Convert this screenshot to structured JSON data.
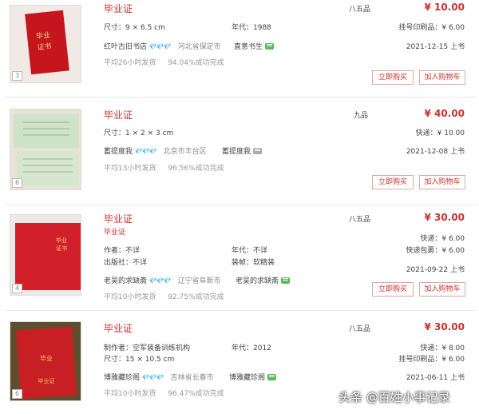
{
  "listings": [
    {
      "image_count": "3",
      "title": "毕业证",
      "size": "尺寸：9 × 6.5 cm",
      "year": "年代：1988",
      "shop": "红叶古旧书店",
      "gems": "💎💎💎",
      "location": "河北省保定市",
      "seller": "直意书生",
      "stats": [
        "平均26小时发货",
        "94.04%成功完成"
      ],
      "condition": "八五品",
      "price": "¥ 10.00",
      "shipping": [
        "挂号印刷品：¥ 6.00"
      ],
      "date": "2021-12-15 上书",
      "buy": "立即购买",
      "cart": "加入购物车"
    },
    {
      "image_count": "6",
      "title": "毕业证",
      "size": "尺寸：1 × 2 × 3 cm",
      "shop": "蓄提度我",
      "gems": "💎💎💎",
      "location": "北京市丰台区",
      "seller": "蓄提度我",
      "stats": [
        "平均13小时发货",
        "96.56%成功完成"
      ],
      "condition": "九品",
      "price": "¥ 40.00",
      "shipping": [
        "快递：¥ 10.00"
      ],
      "date": "2021-12-08 上书",
      "buy": "立即购买",
      "cart": "加入购物车"
    },
    {
      "image_count": "4",
      "title": "毕业证",
      "subtitle": "毕业证",
      "author": "作者：不详",
      "year": "年代：不详",
      "publisher": "出版社：不详",
      "binding": "装帧：软精装",
      "shop": "老吴的求缺斋",
      "gems": "💎💎💎",
      "location": "辽宁省阜新市",
      "seller": "老吴的求缺斋",
      "stats": [
        "平均10小时发货",
        "92.75%成功完成"
      ],
      "condition": "八五品",
      "price": "¥ 30.00",
      "shipping": [
        "快递：¥ 6.00",
        "快递包裹：¥ 6.00"
      ],
      "date": "2021-09-22 上书",
      "buy": "立即购买",
      "cart": "加入购物车"
    },
    {
      "image_count": "6",
      "title": "毕业证",
      "maker": "制作者：空军装备训练机构",
      "year": "年代：2012",
      "size": "尺寸：15 × 10.5 cm",
      "shop": "博雅藏珍阁",
      "gems": "💎💎💎",
      "location": "吉林省长春市",
      "seller": "博雅藏珍阁",
      "stats": [
        "平均10小时发货",
        "96.47%成功完成"
      ],
      "condition": "八五品",
      "price": "¥ 30.00",
      "shipping": [
        "快递：¥ 8.00",
        "挂号印刷品：¥ 6.00"
      ],
      "date": "2021-06-11 上书"
    }
  ],
  "watermark": "头条 @百姓小事记录",
  "colors": {
    "accent": "#c8322e",
    "gem": "#2fb1e6",
    "chat": "#5cb85c"
  }
}
